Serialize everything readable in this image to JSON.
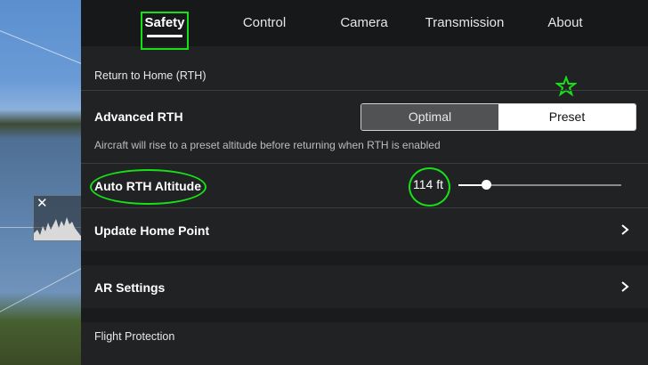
{
  "tabs": [
    {
      "label": "Safety",
      "active": true
    },
    {
      "label": "Control",
      "active": false
    },
    {
      "label": "Camera",
      "active": false
    },
    {
      "label": "Transmission",
      "active": false
    },
    {
      "label": "About",
      "active": false
    }
  ],
  "rth": {
    "section_title": "Return to Home (RTH)",
    "advanced_label": "Advanced RTH",
    "options": [
      "Optimal",
      "Preset"
    ],
    "selected_option": "Preset",
    "description": "Aircraft will rise to a preset altitude before returning when RTH is enabled",
    "altitude_label": "Auto RTH Altitude",
    "altitude_value": "114 ft",
    "altitude_slider_fraction": 0.17
  },
  "rows": {
    "update_home_point": "Update Home Point",
    "ar_settings": "AR Settings"
  },
  "flight_protection": {
    "section_title": "Flight Protection"
  },
  "camera_overlay": {
    "histogram_close": "✕"
  },
  "colors": {
    "highlight": "#17e017",
    "panel_bg": "#202224",
    "tab_bar_bg": "#161819"
  }
}
